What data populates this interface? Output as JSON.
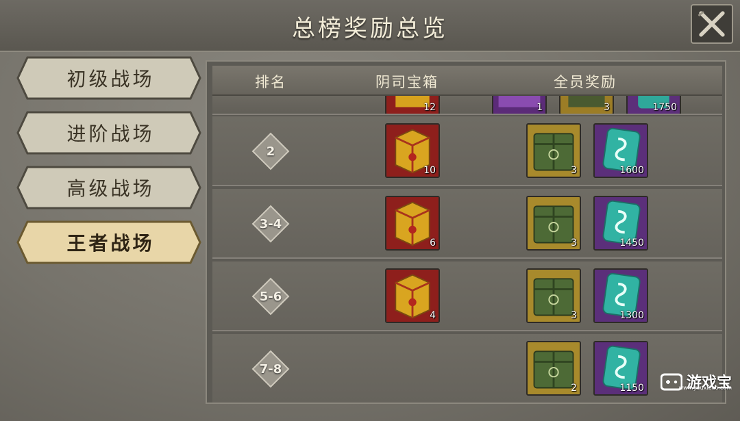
{
  "title": "总榜奖励总览",
  "colors": {
    "tab_active": "#e8d6a8",
    "tab_inactive": "#cfcab8",
    "panel": "#5c5a54"
  },
  "sidebar": {
    "tabs": [
      {
        "label": "初级战场",
        "active": false
      },
      {
        "label": "进阶战场",
        "active": false
      },
      {
        "label": "高级战场",
        "active": false
      },
      {
        "label": "王者战场",
        "active": true
      }
    ]
  },
  "table": {
    "headers": {
      "rank": "排名",
      "chest": "阴司宝箱",
      "team": "全员奖励"
    },
    "partial_row": {
      "chest_qty": "12",
      "item1_qty": "1",
      "item2_qty": "3",
      "item3_qty": "1750"
    },
    "rows": [
      {
        "rank": "2",
        "chest_qty": "10",
        "box_qty": "3",
        "jade_qty": "1600"
      },
      {
        "rank": "3-4",
        "chest_qty": "6",
        "box_qty": "3",
        "jade_qty": "1450"
      },
      {
        "rank": "5-6",
        "chest_qty": "4",
        "box_qty": "3",
        "jade_qty": "1300"
      },
      {
        "rank": "7-8",
        "chest_qty": "",
        "box_qty": "2",
        "jade_qty": "1150"
      }
    ]
  },
  "watermark": {
    "text": "游戏宝",
    "url": "www.youxibao.com"
  }
}
